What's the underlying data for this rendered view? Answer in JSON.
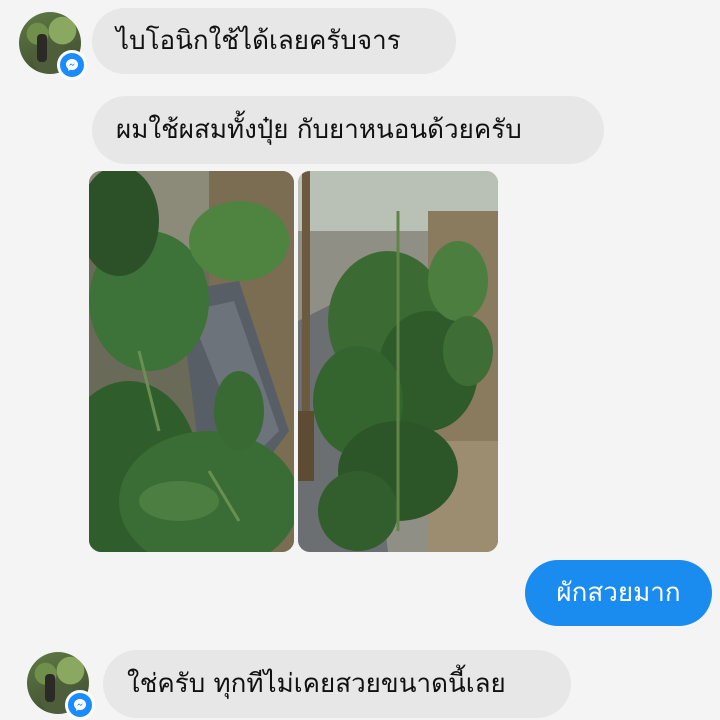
{
  "messages": {
    "m1": "ไบโอนิกใช้ได้เลยครับจาร",
    "m2": "ผมใช้ผสมทั้งปุ๋ย กับยาหนอนด้วยครับ",
    "m3": "ผักสวยมาก",
    "m4": "ใช่ครับ ทุกทีไม่เคยสวยขนาดนี้เลย"
  },
  "icons": {
    "badge": "messenger-icon",
    "avatar": "profile-avatar"
  },
  "colors": {
    "incoming_bubble": "#e7e7e7",
    "outgoing_bubble": "#1a8cf0",
    "background": "#f4f4f4",
    "messenger_badge": "#1a8cff"
  }
}
